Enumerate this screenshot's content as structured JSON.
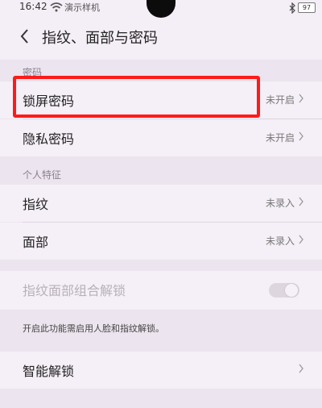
{
  "status_bar": {
    "time": "16:42",
    "carrier": "演示样机",
    "battery": "97"
  },
  "header": {
    "back_icon": "chevron-left-icon",
    "title": "指纹、面部与密码"
  },
  "sections": {
    "password": {
      "label": "密码",
      "items": [
        {
          "label": "锁屏密码",
          "value": "未开启"
        },
        {
          "label": "隐私密码",
          "value": "未开启"
        }
      ]
    },
    "biometrics": {
      "label": "个人特征",
      "items": [
        {
          "label": "指纹",
          "value": "未录入"
        },
        {
          "label": "面部",
          "value": "未录入"
        }
      ]
    },
    "combo": {
      "label": "指纹面部组合解锁",
      "enabled": false,
      "hint": "开启此功能需启用人脸和指纹解锁。"
    },
    "smart": {
      "label": "智能解锁"
    }
  },
  "colors": {
    "highlight": "#ff1a1a",
    "background": "#ece4ee"
  }
}
